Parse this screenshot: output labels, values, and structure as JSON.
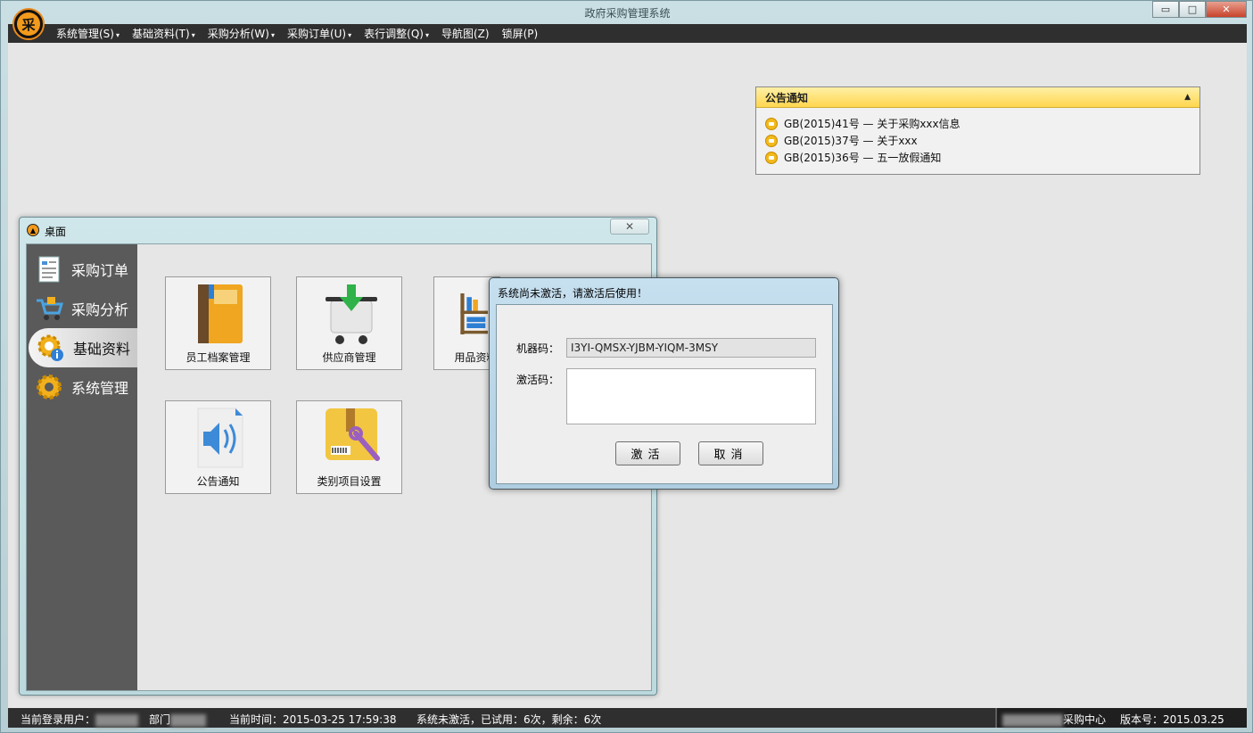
{
  "window": {
    "title": "政府采购管理系统",
    "logo_char": "采",
    "controls": {
      "minimize": "▭",
      "maximize": "□",
      "close": "✕"
    }
  },
  "menubar": {
    "items": [
      {
        "label": "系统管理(S)",
        "caret": "▾"
      },
      {
        "label": "基础资料(T)",
        "caret": "▾"
      },
      {
        "label": "采购分析(W)",
        "caret": "▾"
      },
      {
        "label": "采购订单(U)",
        "caret": "▾"
      },
      {
        "label": "表行调整(Q)",
        "caret": "▾"
      },
      {
        "label": "导航图(Z)",
        "caret": ""
      },
      {
        "label": "锁屏(P)",
        "caret": ""
      }
    ]
  },
  "notice": {
    "title": "公告通知",
    "toggle": "▲",
    "items": [
      "GB(2015)41号 — 关于采购xxx信息",
      "GB(2015)37号 — 关于xxx",
      "GB(2015)36号 — 五一放假通知"
    ]
  },
  "desktop": {
    "title": "桌面",
    "close": "✕",
    "nav": [
      {
        "label": "采购订单",
        "icon": "document-icon"
      },
      {
        "label": "采购分析",
        "icon": "cart-icon"
      },
      {
        "label": "基础资料",
        "icon": "gear-info-icon"
      },
      {
        "label": "系统管理",
        "icon": "gear-icon"
      }
    ],
    "tiles": [
      {
        "label": "员工档案管理",
        "icon": "binder-icon"
      },
      {
        "label": "供应商管理",
        "icon": "cart-download-icon"
      },
      {
        "label": "用品资料",
        "icon": "shelf-icon"
      },
      {
        "label": "公告通知",
        "icon": "speaker-icon"
      },
      {
        "label": "类别项目设置",
        "icon": "box-wrench-icon"
      }
    ]
  },
  "dialog": {
    "title": "系统尚未激活，请激活后使用！",
    "machine_label": "机器码：",
    "machine_code": "I3YI-QMSX-YJBM-YIQM-3MSY",
    "activation_label": "激活码：",
    "activation_code": "",
    "activate_button": "激活",
    "cancel_button": "取消"
  },
  "statusbar": {
    "user_label": "当前登录用户：",
    "dept_label": "部门",
    "time_label": "当前时间：",
    "time_value": "2015-03-25 17:59:38",
    "activation_status": "系统未激活，已试用：6次，剩余：6次",
    "center": "采购中心",
    "version_label": "版本号：",
    "version_value": "2015.03.25"
  }
}
